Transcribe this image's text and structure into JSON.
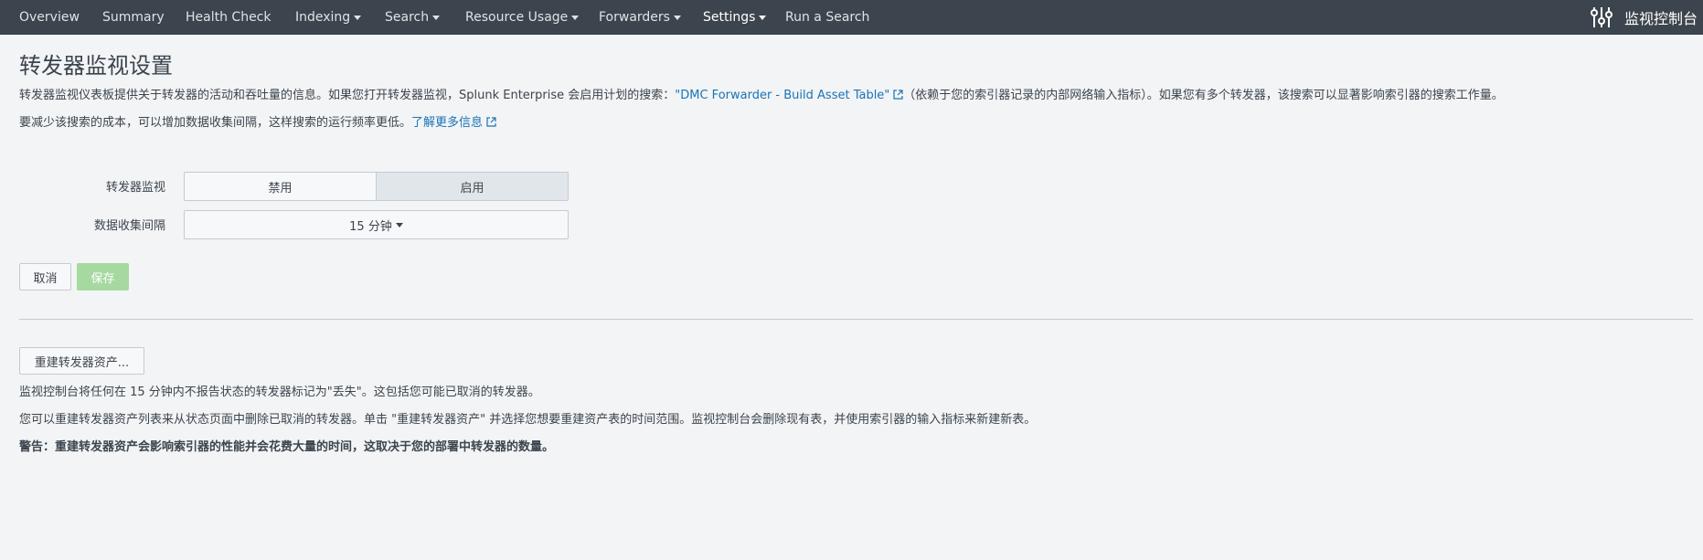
{
  "nav": {
    "items": [
      {
        "label": "Overview",
        "dropdown": false
      },
      {
        "label": "Summary",
        "dropdown": false
      },
      {
        "label": "Health Check",
        "dropdown": false
      },
      {
        "label": "Indexing",
        "dropdown": true
      },
      {
        "label": "Search",
        "dropdown": true
      },
      {
        "label": "Resource Usage",
        "dropdown": true
      },
      {
        "label": "Forwarders",
        "dropdown": true
      },
      {
        "label": "Settings",
        "dropdown": true,
        "active": true
      },
      {
        "label": "Run a Search",
        "dropdown": false
      }
    ],
    "brand_icon": "sliders-icon",
    "brand_title": "监视控制台"
  },
  "page": {
    "title": "转发器监视设置",
    "desc1_pre": "转发器监视仪表板提供关于转发器的活动和吞吐量的信息。如果您打开转发器监视，Splunk Enterprise 会启用计划的搜索：",
    "desc1_link": "\"DMC Forwarder - Build Asset Table\"",
    "desc1_post": "（依赖于您的索引器记录的内部网络输入指标）。如果您有多个转发器，该搜索可以显著影响索引器的搜索工作量。",
    "desc2_pre": "要减少该搜索的成本，可以增加数据收集间隔，这样搜索的运行频率更低。",
    "desc2_link": "了解更多信息"
  },
  "form": {
    "monitoring_label": "转发器监视",
    "monitoring_options": [
      "禁用",
      "启用"
    ],
    "monitoring_selected": "启用",
    "interval_label": "数据收集间隔",
    "interval_value": "15 分钟"
  },
  "actions": {
    "cancel_label": "取消",
    "save_label": "保存"
  },
  "rebuild": {
    "button_label": "重建转发器资产...",
    "info1": "监视控制台将任何在 15 分钟内不报告状态的转发器标记为\"丢失\"。这包括您可能已取消的转发器。",
    "info2": "您可以重建转发器资产列表来从状态页面中删除已取消的转发器。单击 \"重建转发器资产\" 并选择您想要重建资产表的时间范围。监视控制台会删除现有表，并使用索引器的输入指标来新建新表。",
    "warning": "警告：重建转发器资产会影响索引器的性能并会花费大量的时间，这取决于您的部署中转发器的数量。"
  },
  "colors": {
    "nav_bg": "#3c444d",
    "page_bg": "#f2f4f5",
    "link": "#1a73b8",
    "save_disabled": "#a6d9a0"
  }
}
